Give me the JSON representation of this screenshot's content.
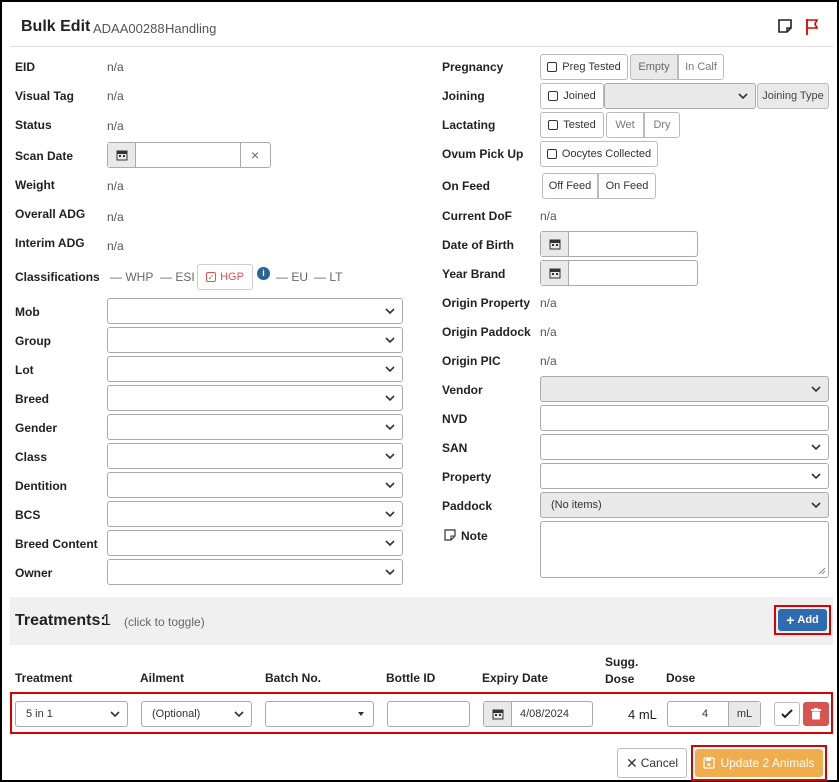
{
  "header": {
    "title": "Bulk Edit",
    "subtitle_id": "ADAA00288",
    "subtitle_mode": "Handling"
  },
  "left": {
    "eid": {
      "label": "EID",
      "value": "n/a"
    },
    "visual_tag": {
      "label": "Visual Tag",
      "value": "n/a"
    },
    "status": {
      "label": "Status",
      "value": "n/a"
    },
    "scan_date": {
      "label": "Scan Date",
      "clear": "×"
    },
    "weight": {
      "label": "Weight",
      "value": "n/a"
    },
    "overall_adg": {
      "label": "Overall ADG",
      "value": "n/a"
    },
    "interim_adg": {
      "label": "Interim ADG",
      "value": "n/a"
    },
    "classifications": {
      "label": "Classifications",
      "items": [
        "— WHP",
        "— ESI",
        "HGP",
        "— EU",
        "— LT"
      ]
    },
    "dropdowns": [
      {
        "label": "Mob"
      },
      {
        "label": "Group"
      },
      {
        "label": "Lot"
      },
      {
        "label": "Breed"
      },
      {
        "label": "Gender"
      },
      {
        "label": "Class"
      },
      {
        "label": "Dentition"
      },
      {
        "label": "BCS"
      },
      {
        "label": "Breed Content"
      },
      {
        "label": "Owner"
      }
    ]
  },
  "right": {
    "pregnancy": {
      "label": "Pregnancy",
      "preg_tested": "Preg Tested",
      "empty": "Empty",
      "in_calf": "In Calf"
    },
    "joining": {
      "label": "Joining",
      "joined": "Joined",
      "joining_type": "Joining Type"
    },
    "lactating": {
      "label": "Lactating",
      "tested": "Tested",
      "wet": "Wet",
      "dry": "Dry"
    },
    "ovum": {
      "label": "Ovum Pick Up",
      "oocytes": "Oocytes Collected"
    },
    "on_feed": {
      "label": "On Feed",
      "off": "Off Feed",
      "on": "On Feed"
    },
    "current_dof": {
      "label": "Current DoF",
      "value": "n/a"
    },
    "dob": {
      "label": "Date of Birth"
    },
    "year_brand": {
      "label": "Year Brand"
    },
    "origin_property": {
      "label": "Origin Property",
      "value": "n/a"
    },
    "origin_paddock": {
      "label": "Origin Paddock",
      "value": "n/a"
    },
    "origin_pic": {
      "label": "Origin PIC",
      "value": "n/a"
    },
    "vendor": {
      "label": "Vendor"
    },
    "nvd": {
      "label": "NVD"
    },
    "san": {
      "label": "SAN"
    },
    "property": {
      "label": "Property"
    },
    "paddock": {
      "label": "Paddock",
      "value": "(No items)"
    },
    "note": {
      "label": "Note"
    }
  },
  "treatments": {
    "title": "Treatments:",
    "count": "1",
    "hint": "(click to toggle)",
    "add_label": "Add",
    "columns": [
      "Treatment",
      "Ailment",
      "Batch No.",
      "Bottle ID",
      "Expiry Date",
      "Sugg.\nDose",
      "Dose"
    ],
    "row": {
      "treatment": "5 in 1",
      "ailment": "(Optional)",
      "batch": "",
      "bottle": "",
      "expiry": "4/08/2024",
      "sugg_dose": "4 mL",
      "dose": "4",
      "dose_unit": "mL"
    }
  },
  "footer": {
    "cancel": "Cancel",
    "update": "Update 2 Animals"
  },
  "colors": {
    "accent_blue": "#2e6bb0",
    "danger_red": "#d9534f",
    "update_orange": "#f0ad4e",
    "highlight_red": "#d00000"
  }
}
